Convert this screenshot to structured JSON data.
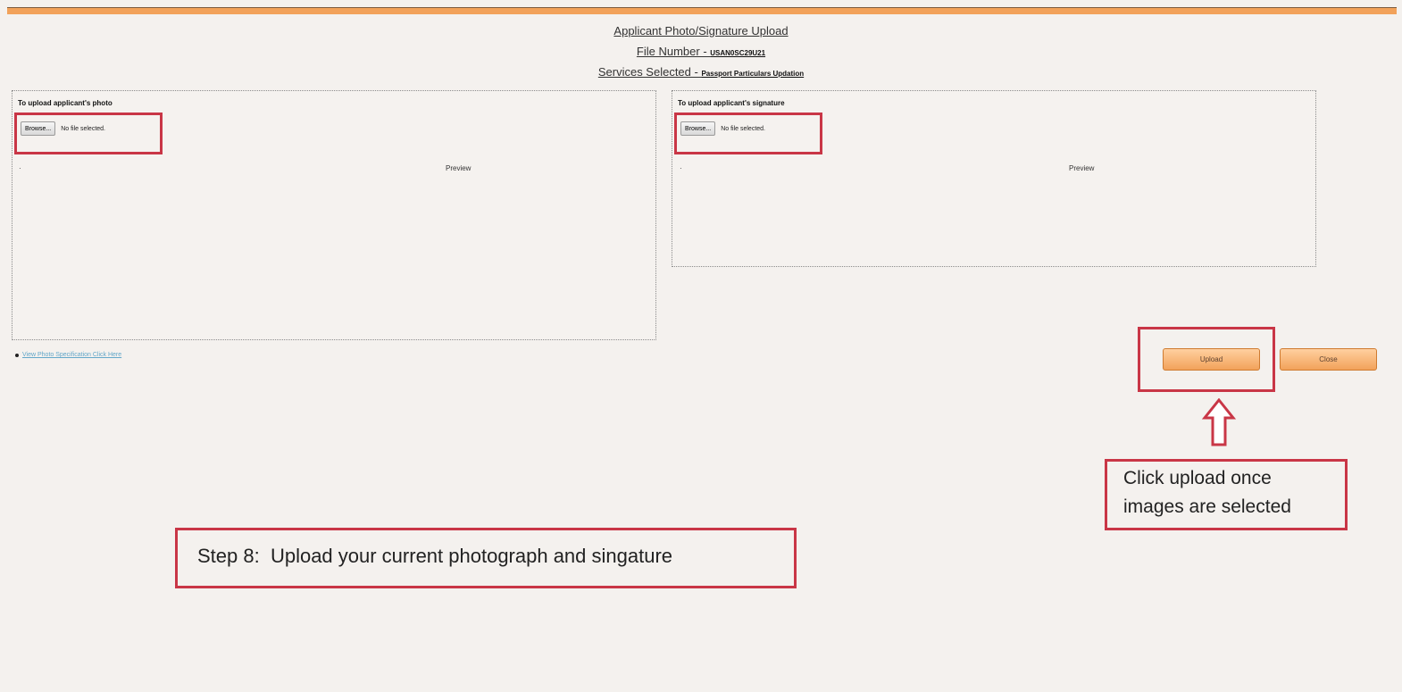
{
  "header": {
    "title": "Applicant Photo/Signature Upload",
    "file_number_label": "File Number - ",
    "file_number_value": "USAN0SC29U21",
    "services_label": "Services Selected - ",
    "services_value": "Passport Particulars Updation"
  },
  "photo_panel": {
    "title": "To upload applicant's photo",
    "browse_label": "Browse...",
    "file_status": "No file selected.",
    "preview_label": "Preview",
    "preview_marker": "·"
  },
  "signature_panel": {
    "title": "To upload applicant's signature",
    "browse_label": "Browse...",
    "file_status": "No file selected.",
    "preview_label": "Preview",
    "preview_marker": "·"
  },
  "spec_link": {
    "label": "View Photo Specification Click Here"
  },
  "actions": {
    "upload_label": "Upload",
    "close_label": "Close"
  },
  "annotations": {
    "upload_hint": "Click upload once\nimages are selected",
    "step_text": "Step 8:  Upload your current photograph and singature",
    "arrow_icon": "up-arrow-icon",
    "accent_red": "#c93646",
    "accent_orange": "#f2a25a"
  }
}
